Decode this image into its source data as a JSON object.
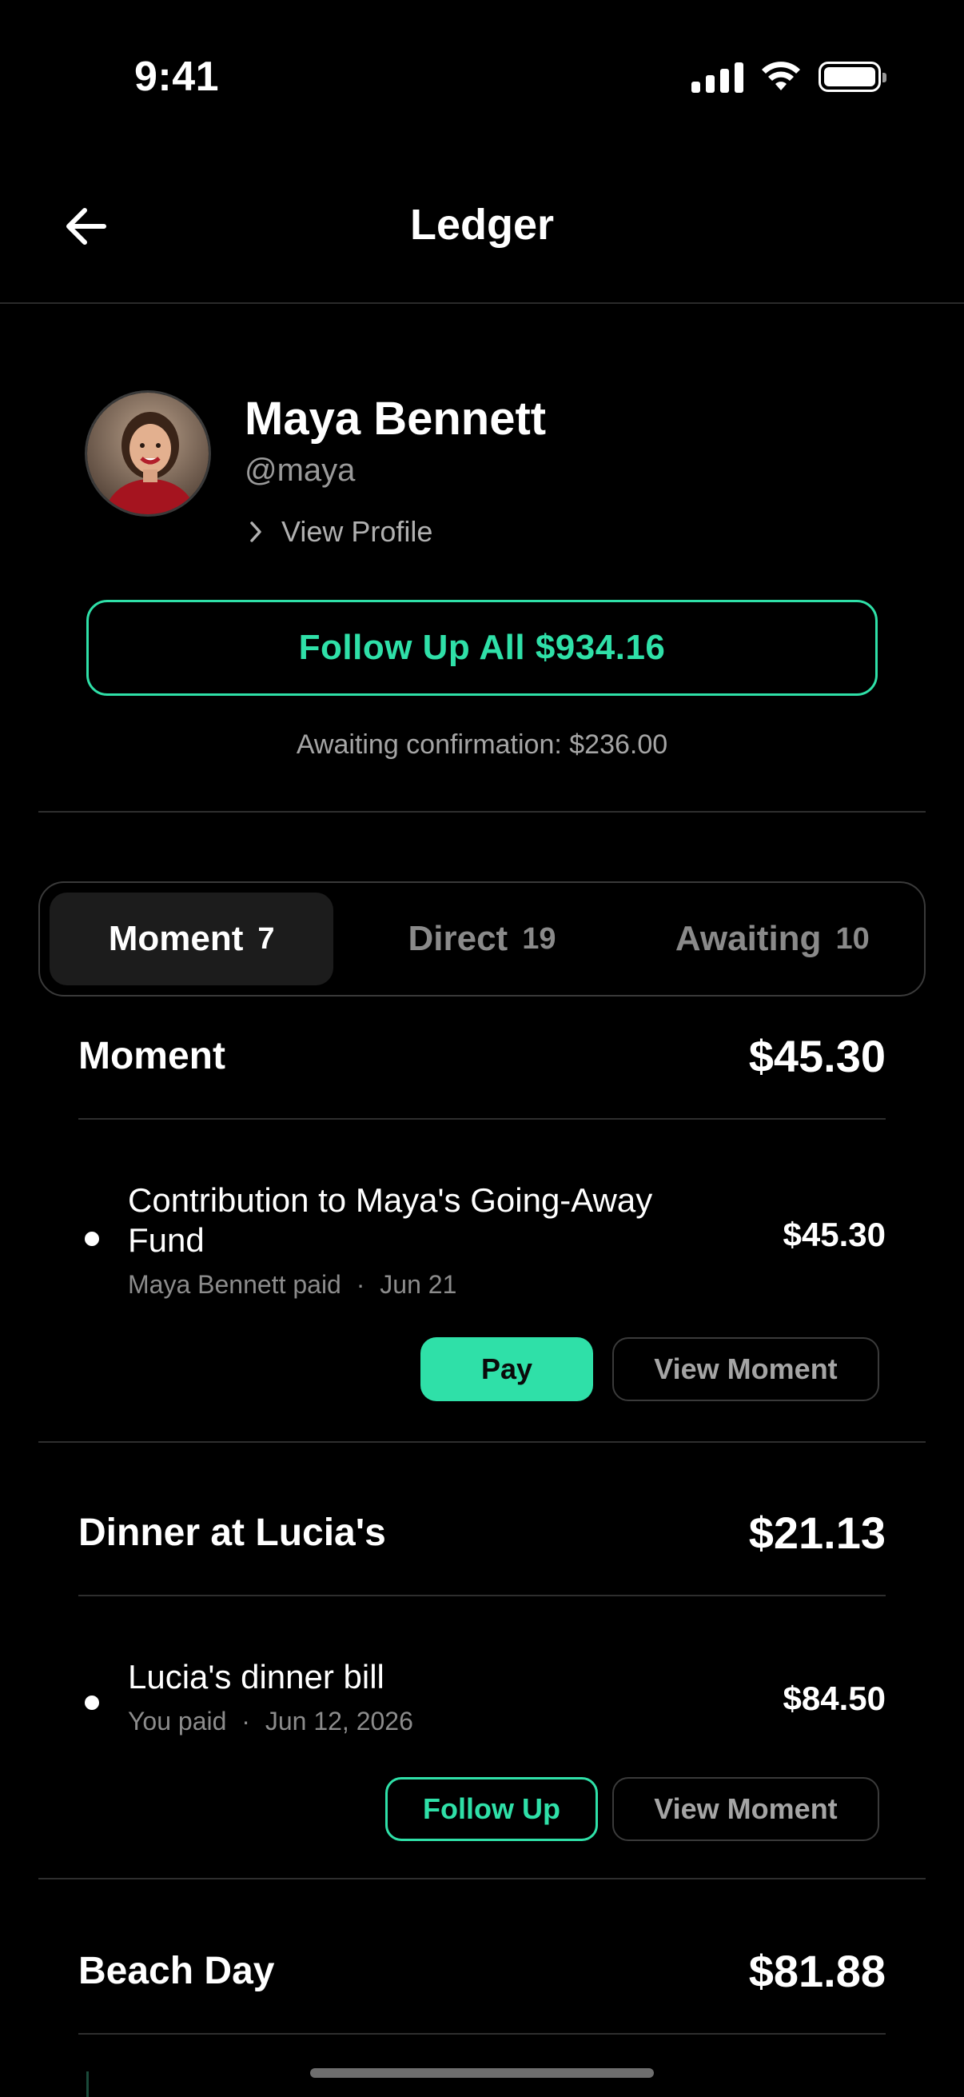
{
  "status": {
    "time": "9:41"
  },
  "header": {
    "title": "Ledger"
  },
  "profile": {
    "name": "Maya Bennett",
    "handle": "@maya",
    "view_profile": "View Profile"
  },
  "follow_all": {
    "label": "Follow Up All $934.16"
  },
  "awaiting_note": "Awaiting confirmation: $236.00",
  "tabs": [
    {
      "label": "Moment",
      "count": "7",
      "active": true
    },
    {
      "label": "Direct",
      "count": "19",
      "active": false
    },
    {
      "label": "Awaiting",
      "count": "10",
      "active": false
    }
  ],
  "moments": [
    {
      "title": "Moment",
      "amount": "$45.30",
      "item": {
        "title_line1": "Contribution to Maya's Going-Away",
        "title_line2": "Fund",
        "payer": "Maya Bennett paid",
        "date": "Jun 21",
        "amount": "$45.30",
        "primary_action": "Pay",
        "secondary_action": "View Moment"
      }
    },
    {
      "title": "Dinner at Lucia's",
      "amount": "$21.13",
      "item": {
        "title_line1": "Lucia's dinner bill",
        "payer": "You paid",
        "date": "Jun 12, 2026",
        "amount": "$84.50",
        "primary_action": "Follow Up",
        "secondary_action": "View Moment"
      }
    },
    {
      "title": "Beach Day",
      "amount": "$81.88"
    }
  ],
  "colors": {
    "accent": "#2fe0a8",
    "background": "#000000"
  }
}
